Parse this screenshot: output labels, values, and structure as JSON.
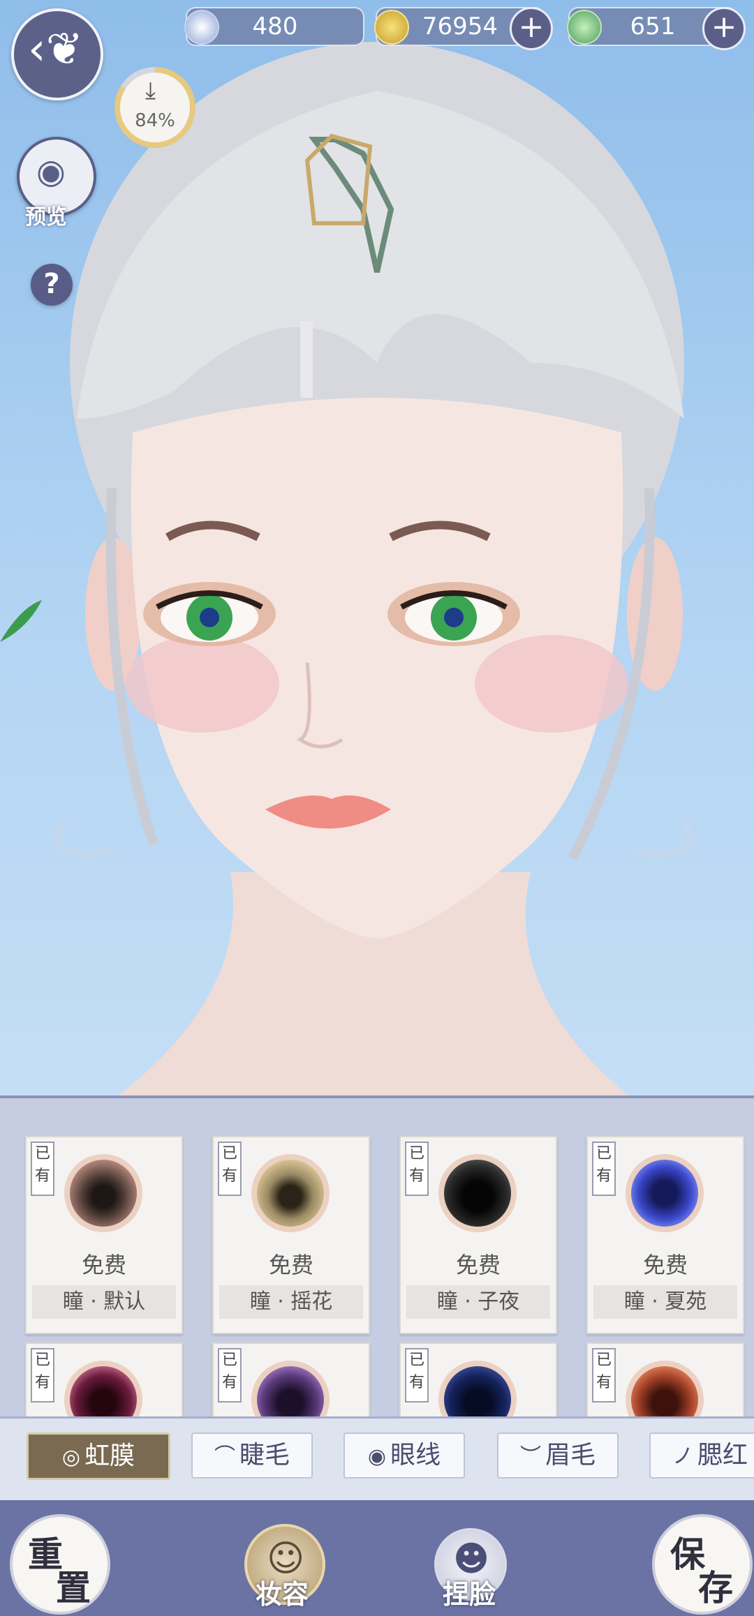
{
  "top_bar": {
    "currencies": [
      {
        "icon": "jade-icon",
        "value": "480"
      },
      {
        "icon": "coin-icon",
        "value": "76954"
      },
      {
        "icon": "crest-icon",
        "value": "651"
      }
    ],
    "download_percent": "84%",
    "preview_label": "预览",
    "help_label": "?"
  },
  "items": [
    {
      "owned": "已有",
      "price": "免费",
      "name": "瞳 · 默认",
      "colors": [
        "#4a3a33",
        "#1e1714",
        "#c9958a"
      ]
    },
    {
      "owned": "已有",
      "price": "免费",
      "name": "瞳 · 摇花",
      "colors": [
        "#9a8a63",
        "#2a2418",
        "#e6cf9c"
      ]
    },
    {
      "owned": "已有",
      "price": "免费",
      "name": "瞳 · 子夜",
      "colors": [
        "#2a2a2a",
        "#050505",
        "#6d6d6d"
      ]
    },
    {
      "owned": "已有",
      "price": "免费",
      "name": "瞳 · 夏苑",
      "colors": [
        "#3a47c8",
        "#151a5a",
        "#8fa0ff"
      ]
    },
    {
      "owned": "已有",
      "price": "",
      "name": "",
      "colors": [
        "#6a1b3c",
        "#25060f",
        "#e07aa0"
      ]
    },
    {
      "owned": "已有",
      "price": "",
      "name": "",
      "colors": [
        "#5a3a7a",
        "#1c0f2a",
        "#b58ad8"
      ]
    },
    {
      "owned": "已有",
      "price": "",
      "name": "",
      "colors": [
        "#15235c",
        "#060a22",
        "#4658a8"
      ]
    },
    {
      "owned": "已有",
      "price": "",
      "name": "",
      "colors": [
        "#a9442b",
        "#3e120a",
        "#f0946a"
      ]
    }
  ],
  "tabs": [
    {
      "label": "虹膜",
      "icon": "◎",
      "active": true
    },
    {
      "label": "睫毛",
      "icon": "⌒",
      "active": false
    },
    {
      "label": "眼线",
      "icon": "◉",
      "active": false
    },
    {
      "label": "眉毛",
      "icon": "︶",
      "active": false
    },
    {
      "label": "腮红",
      "icon": "ノ",
      "active": false
    }
  ],
  "bottom": {
    "reset": [
      "重",
      "置"
    ],
    "makeup": "妆容",
    "face": "捏脸",
    "save": [
      "保",
      "存"
    ]
  }
}
